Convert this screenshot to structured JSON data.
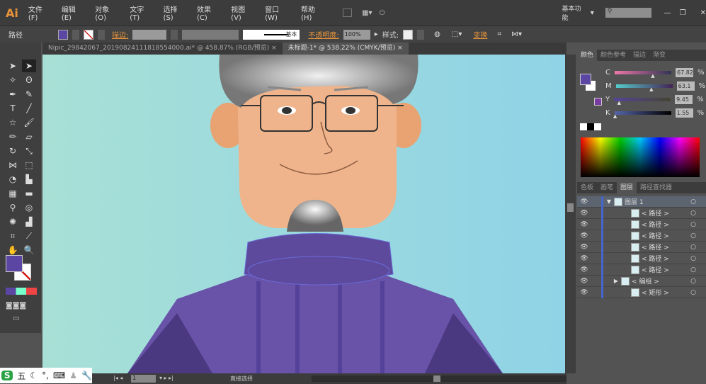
{
  "app": {
    "logo": "Ai",
    "menus": [
      "文件(F)",
      "编辑(E)",
      "对象(O)",
      "文字(T)",
      "选择(S)",
      "效果(C)",
      "视图(V)",
      "窗口(W)",
      "帮助(H)"
    ],
    "workspace": "基本功能",
    "search_placeholder": ""
  },
  "control": {
    "object_type": "路径",
    "stroke_label": "描边:",
    "stroke_style": "基本",
    "opacity_label": "不透明度:",
    "opacity": "100%",
    "style_label": "样式:",
    "transform": "变换",
    "fill_color": "#5b46a3"
  },
  "tabs": [
    {
      "label": "Nipic_29842067_20190824111818554000.ai* @ 458.87% (RGB/预览)"
    },
    {
      "label": "未标题-1* @ 538.22% (CMYK/预览)"
    }
  ],
  "color_panel": {
    "tabs": [
      "颜色",
      "颜色参考",
      "描边",
      "渐变"
    ],
    "channels": [
      {
        "name": "C",
        "value": "67.82",
        "pct": 67.82
      },
      {
        "name": "M",
        "value": "63.1",
        "pct": 63.1
      },
      {
        "name": "Y",
        "value": "9.45",
        "pct": 9.45
      },
      {
        "name": "K",
        "value": "1.55",
        "pct": 1.55
      }
    ],
    "percent": "%"
  },
  "layers_panel": {
    "tabs": [
      "色板",
      "画笔",
      "图层",
      "路径查找器"
    ],
    "layers": [
      {
        "name": "图层 1"
      },
      {
        "name": "< 路径 >"
      },
      {
        "name": "< 路径 >"
      },
      {
        "name": "< 路径 >"
      },
      {
        "name": "< 路径 >"
      },
      {
        "name": "< 路径 >"
      },
      {
        "name": "< 路径 >"
      },
      {
        "name": "< 编组 >"
      },
      {
        "name": "< 矩形 >"
      }
    ]
  },
  "status": {
    "page": "1",
    "tool": "直接选择"
  },
  "ime": {
    "mode": "五"
  }
}
